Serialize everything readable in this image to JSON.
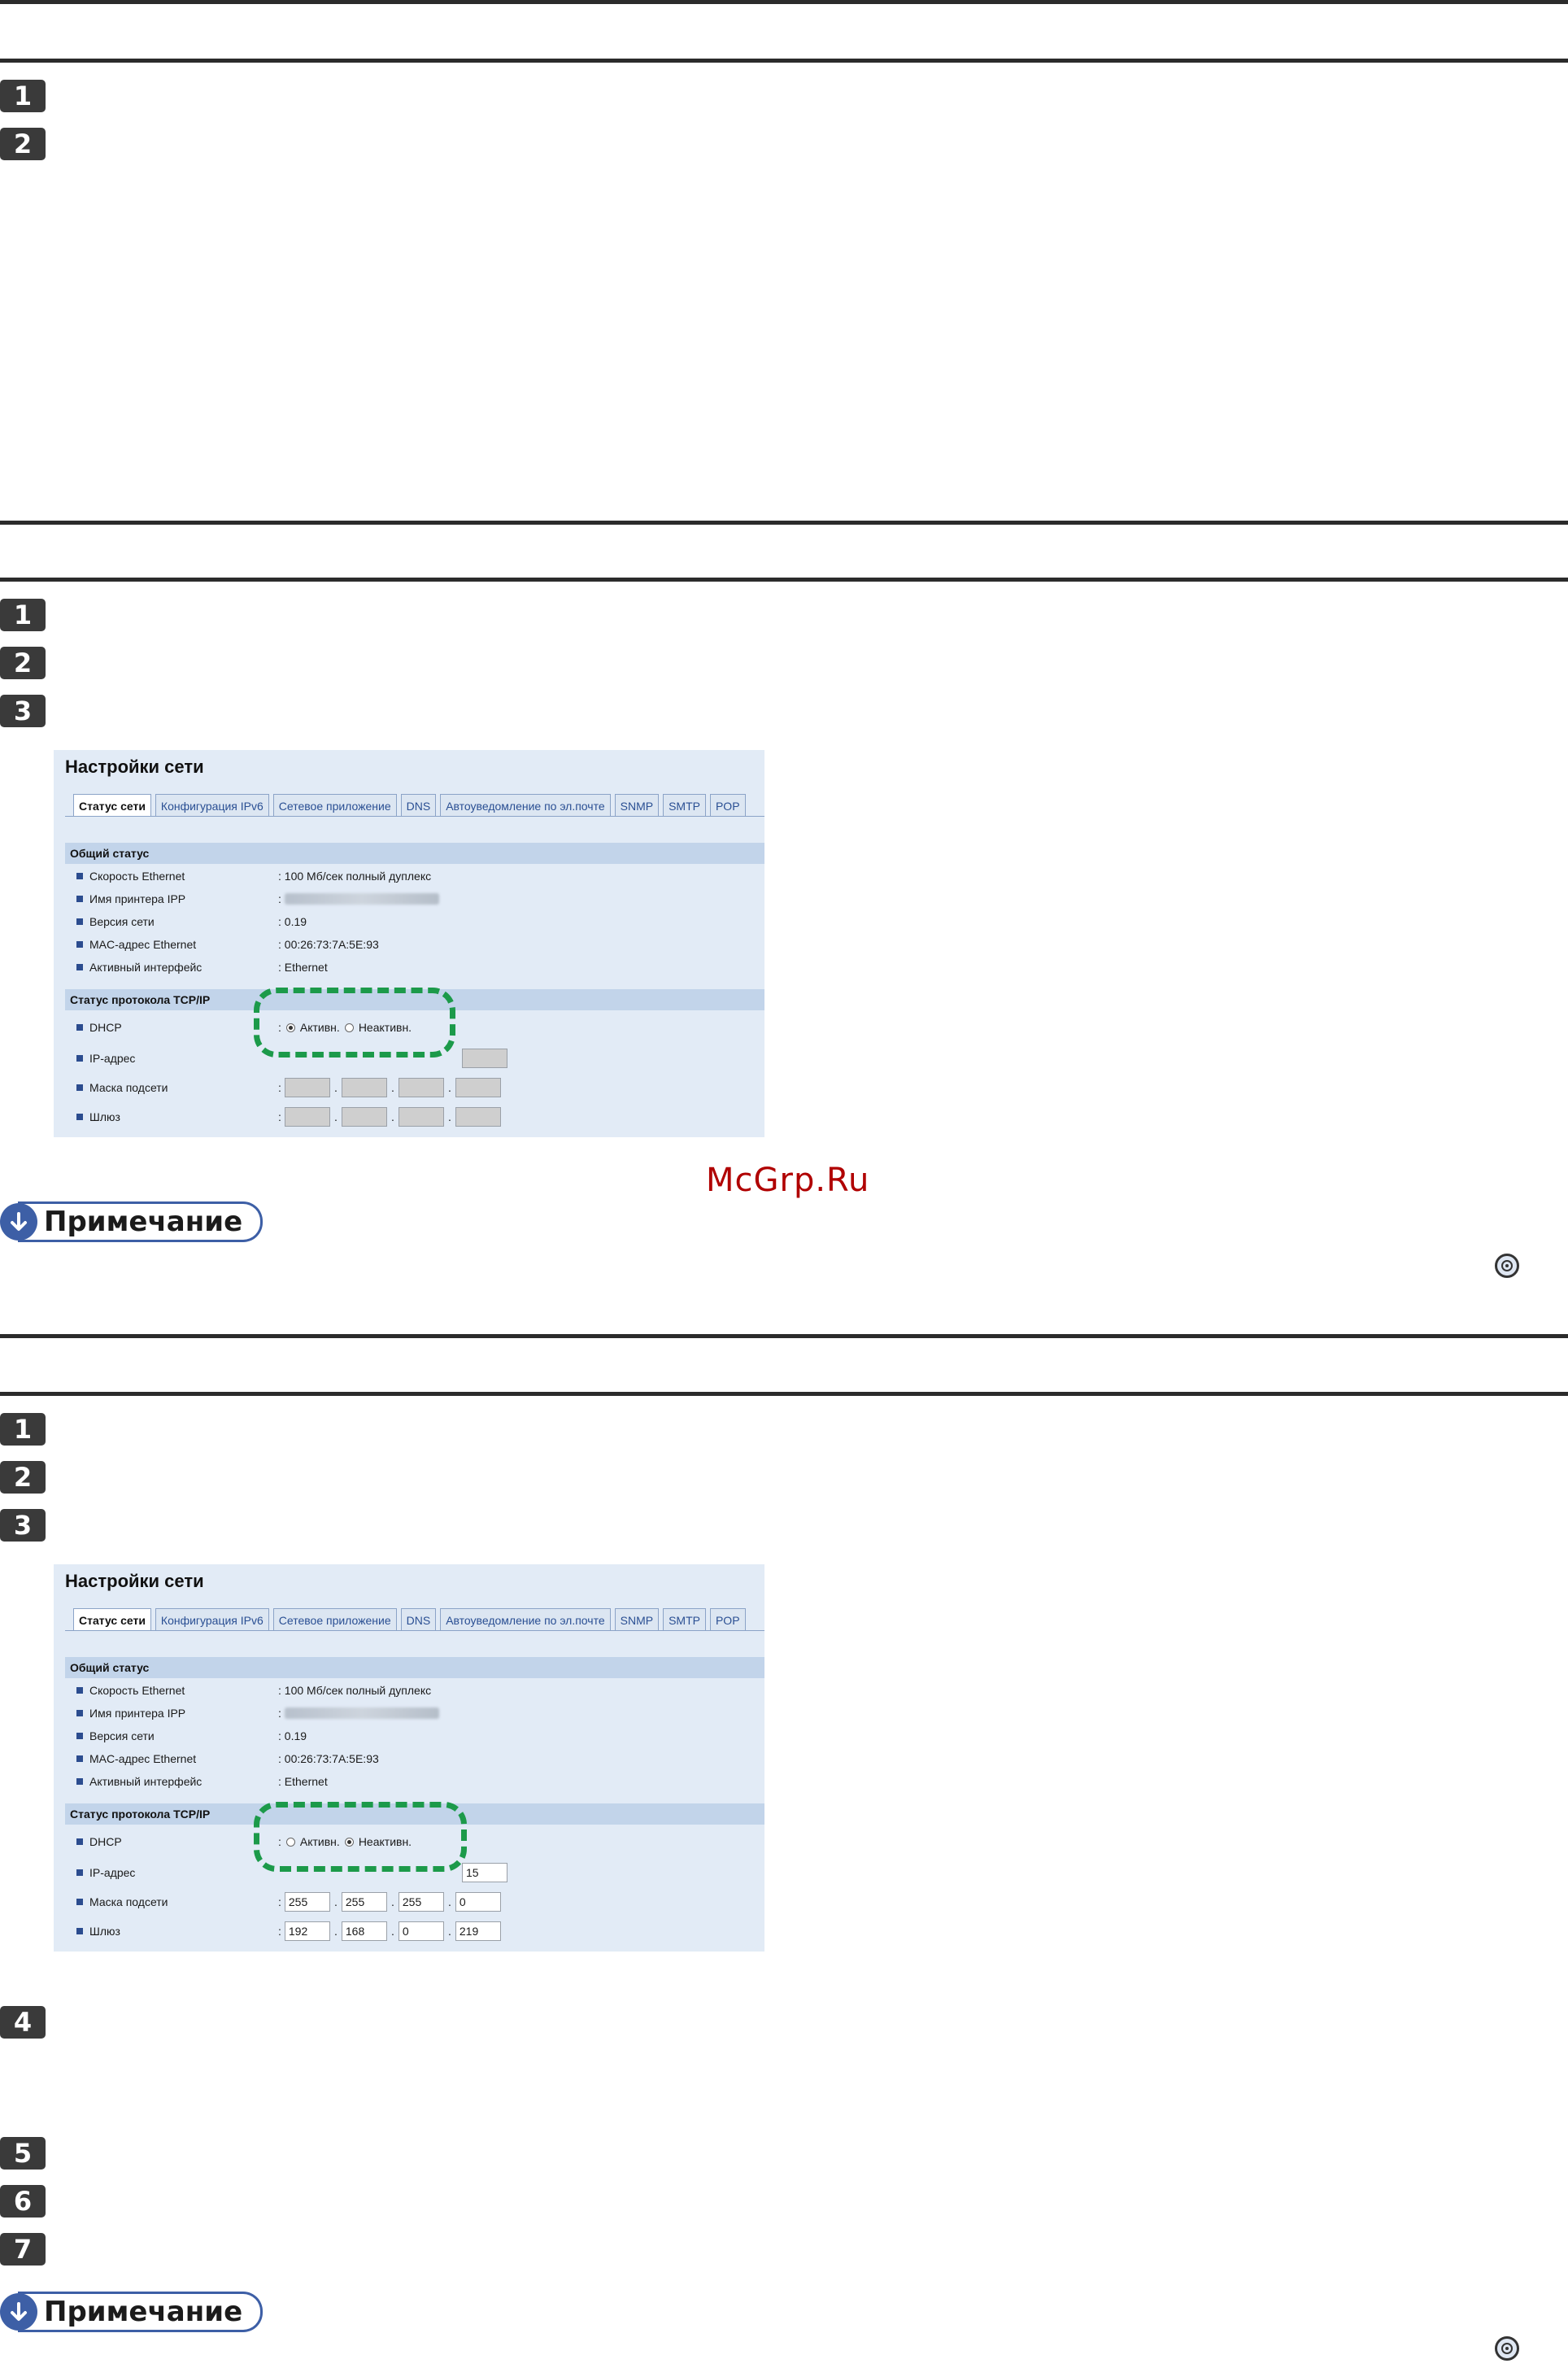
{
  "steps": {
    "s1": [
      "1",
      "2"
    ],
    "s2": [
      "1",
      "2",
      "3"
    ],
    "s3": [
      "1",
      "2",
      "3",
      "4",
      "5",
      "6",
      "7"
    ]
  },
  "note_label": "Примечание",
  "watermark": "McGrp.Ru",
  "screenshot1": {
    "title": "Настройки сети",
    "tabs": [
      "Статус сети",
      "Конфигурация IPv6",
      "Сетевое приложение",
      "DNS",
      "Автоуведомление по эл.почте",
      "SNMP",
      "SMTP",
      "POP"
    ],
    "general_header": "Общий статус",
    "general_rows": [
      {
        "label": "Скорость Ethernet",
        "value": ": 100 Мб/сек полный дуплекс"
      },
      {
        "label": "Имя принтера IPP",
        "value": ":"
      },
      {
        "label": "Версия сети",
        "value": ": 0.19"
      },
      {
        "label": "MAC-адрес Ethernet",
        "value": ": 00:26:73:7A:5E:93"
      },
      {
        "label": "Активный интерфейс",
        "value": ": Ethernet"
      }
    ],
    "tcpip_header": "Статус протокола TCP/IP",
    "dhcp_label": "DHCP",
    "radio_active": "Активн.",
    "radio_inactive": "Неактивн.",
    "ip_label": "IP-адрес",
    "mask_label": "Маска подсети",
    "gateway_label": "Шлюз"
  },
  "screenshot2": {
    "title": "Настройки сети",
    "tabs": [
      "Статус сети",
      "Конфигурация IPv6",
      "Сетевое приложение",
      "DNS",
      "Автоуведомление по эл.почте",
      "SNMP",
      "SMTP",
      "POP"
    ],
    "general_header": "Общий статус",
    "general_rows": [
      {
        "label": "Скорость Ethernet",
        "value": ": 100 Мб/сек полный дуплекс"
      },
      {
        "label": "Имя принтера IPP",
        "value": ":"
      },
      {
        "label": "Версия сети",
        "value": ": 0.19"
      },
      {
        "label": "MAC-адрес Ethernet",
        "value": ": 00:26:73:7A:5E:93"
      },
      {
        "label": "Активный интерфейс",
        "value": ": Ethernet"
      }
    ],
    "tcpip_header": "Статус протокола TCP/IP",
    "dhcp_label": "DHCP",
    "radio_active": "Активн.",
    "radio_inactive": "Неактивн.",
    "ip_label": "IP-адрес",
    "ip_last": "15",
    "mask_label": "Маска подсети",
    "mask": [
      "255",
      "255",
      "255",
      "0"
    ],
    "gateway_label": "Шлюз",
    "gateway": [
      "192",
      "168",
      "0",
      "219"
    ]
  },
  "colors": {
    "accent": "#3d5fa6",
    "highlight": "#1c9a4a",
    "panel_bg": "#e2ebf6",
    "header_bg": "#c2d4ea"
  }
}
